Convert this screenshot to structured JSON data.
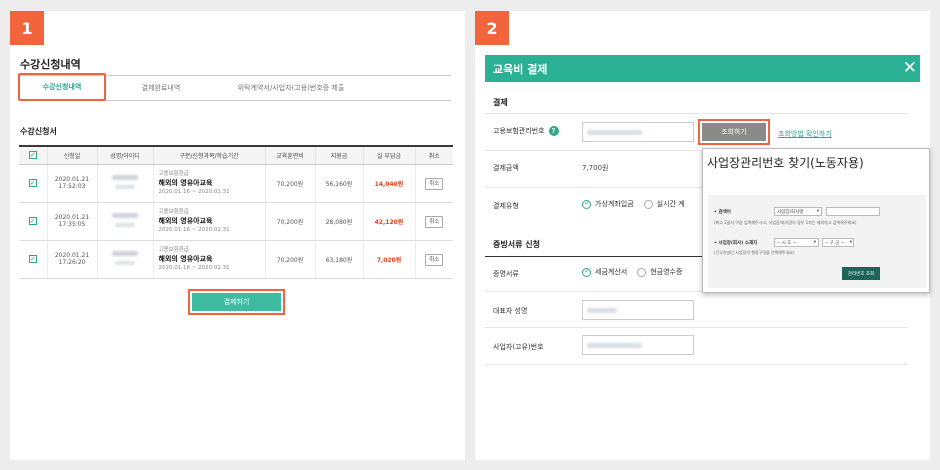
{
  "step1": {
    "badge": "1"
  },
  "step2": {
    "badge": "2"
  },
  "panel1": {
    "title": "수강신청내역",
    "tabs": [
      "수강신청내역",
      "결제완료내역",
      "위탁계약서/사업자(고용)번호증 제출"
    ],
    "section_title": "수강신청서",
    "table": {
      "headers": [
        "",
        "신청일",
        "성명/아이디",
        "구분/신청과목/학습기간",
        "교육훈련비",
        "지원금",
        "실 부담금",
        "취소"
      ],
      "rows": [
        {
          "date": "2020.01.21",
          "time": "17:52:03",
          "category": "고용보험환급",
          "course": "해외의 영유아교육",
          "period": "2020.01.16 ~ 2020.01.31",
          "fee": "70,200원",
          "subsidy": "56,160원",
          "actual": "14,040원",
          "cancel": "취소"
        },
        {
          "date": "2020.01.21",
          "time": "17:35:05",
          "category": "고용보험환급",
          "course": "해외의 영유아교육",
          "period": "2020.01.16 ~ 2020.01.31",
          "fee": "70,200원",
          "subsidy": "28,080원",
          "actual": "42,120원",
          "cancel": "취소"
        },
        {
          "date": "2020.01.21",
          "time": "17:26:20",
          "category": "고용보험환급",
          "course": "해외의 영유아교육",
          "period": "2020.01.16 ~ 2020.01.31",
          "fee": "70,200원",
          "subsidy": "63,180원",
          "actual": "7,020원",
          "cancel": "취소"
        }
      ]
    },
    "pay_button": "결제하기"
  },
  "panel2": {
    "header": "교육비 결제",
    "close": "✕",
    "section_payment": "결제",
    "label_insurance_no": "고용보험관리번호",
    "help": "?",
    "lookup_button": "조회하기",
    "lookup_link": "조회방법 확인하기",
    "label_amount": "결제금액",
    "amount": "7,700원",
    "label_pay_type": "결제유형",
    "pay_type_options": [
      "가상계좌입금",
      "실시간 계"
    ],
    "section_receipt": "증빙서류 신청",
    "label_receipt": "증명서류",
    "receipt_options": [
      "세금계산서",
      "현금영수증"
    ],
    "label_rep_name": "대표자 성명",
    "label_biz_no": "사업자(고유)번호",
    "popup": {
      "title": "사업장관리번호 찾기(노동자용)",
      "search_label": "• 검색어",
      "search_select": "사업장/회사명",
      "search_note": "(최소 2글자 이상 입력해주시고, 사업장/회사명의 경우 1자는 제외하고 검색해주세요)",
      "region_label": "• 사업장(회사) 소재지",
      "region_select1": "-- 시.도 --",
      "region_select2": "-- 구.군 --",
      "region_note": "(근무하셨던 사업장의 행정구역을 선택해주세요)",
      "button": "관리번호 조회"
    }
  }
}
